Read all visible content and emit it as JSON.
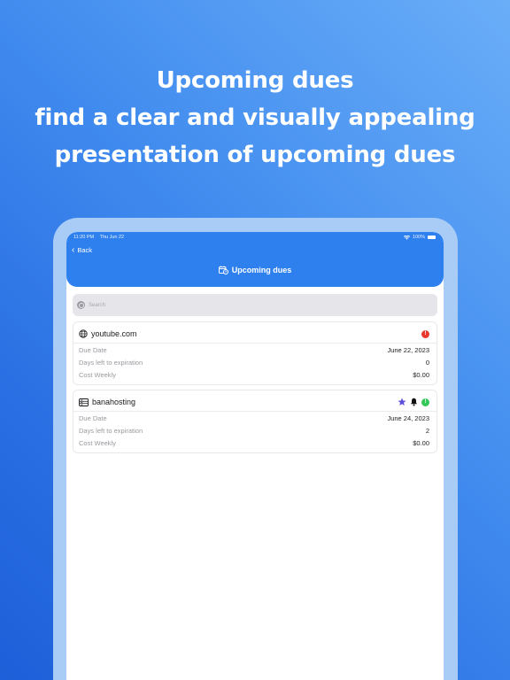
{
  "headline": {
    "line1": "Upcoming dues",
    "line2": "find a clear and visually appealing",
    "line3": "presentation of upcoming dues"
  },
  "status_bar": {
    "time": "11:20 PM",
    "date": "Thu Jun 22",
    "battery": "100%"
  },
  "nav": {
    "back_label": "Back",
    "title": "Upcoming dues",
    "accent": "#2f80ef"
  },
  "search": {
    "placeholder": "Search",
    "value": ""
  },
  "items": [
    {
      "name": "youtube.com",
      "icon": "globe-icon",
      "badges": [
        {
          "icon": "exclamation-icon",
          "color": "#e8392f"
        }
      ],
      "due_date_label": "Due Date",
      "due_date": "June 22, 2023",
      "days_label": "Days left to expiration",
      "days": "0",
      "cost_label": "Cost Weekly",
      "cost": "$0.00"
    },
    {
      "name": "banahosting",
      "icon": "server-icon",
      "badges": [
        {
          "icon": "star-icon",
          "color": "#5b4fd8"
        },
        {
          "icon": "bell-icon",
          "color": "#111111"
        },
        {
          "icon": "exclamation-icon",
          "color": "#34c759"
        }
      ],
      "due_date_label": "Due Date",
      "due_date": "June 24, 2023",
      "days_label": "Days left to expiration",
      "days": "2",
      "cost_label": "Cost Weekly",
      "cost": "$0.00"
    }
  ]
}
